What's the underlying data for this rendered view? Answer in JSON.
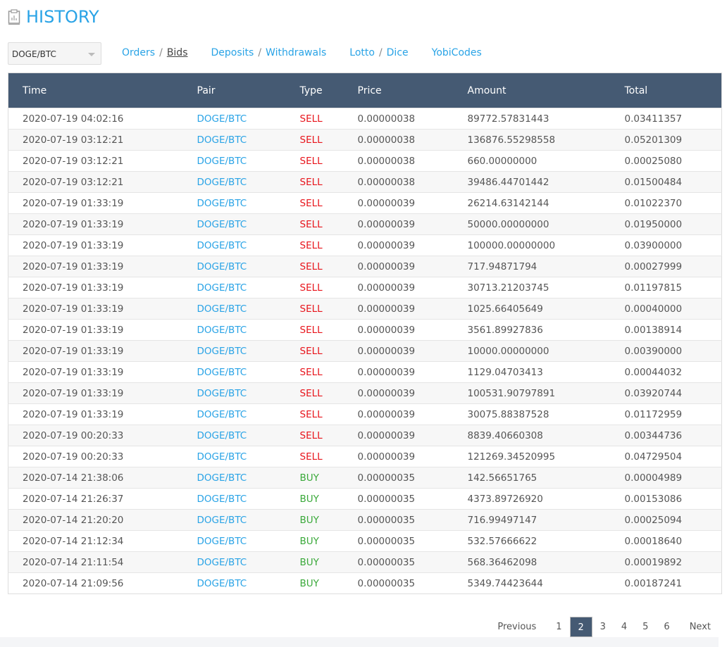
{
  "header": {
    "title": "HISTORY",
    "icon": "clipboard-chart-icon"
  },
  "pair_select": {
    "value": "DOGE/BTC"
  },
  "nav": [
    {
      "items": [
        "Orders",
        "Bids"
      ],
      "active": "Bids"
    },
    {
      "items": [
        "Deposits",
        "Withdrawals"
      ]
    },
    {
      "items": [
        "Lotto",
        "Dice"
      ]
    },
    {
      "items": [
        "YobiCodes"
      ]
    }
  ],
  "nav_separator": "/",
  "table": {
    "columns": [
      "Time",
      "Pair",
      "Type",
      "Price",
      "Amount",
      "Total"
    ],
    "rows": [
      [
        "2020-07-19 04:02:16",
        "DOGE/BTC",
        "SELL",
        "0.00000038",
        "89772.57831443",
        "0.03411357"
      ],
      [
        "2020-07-19 03:12:21",
        "DOGE/BTC",
        "SELL",
        "0.00000038",
        "136876.55298558",
        "0.05201309"
      ],
      [
        "2020-07-19 03:12:21",
        "DOGE/BTC",
        "SELL",
        "0.00000038",
        "660.00000000",
        "0.00025080"
      ],
      [
        "2020-07-19 03:12:21",
        "DOGE/BTC",
        "SELL",
        "0.00000038",
        "39486.44701442",
        "0.01500484"
      ],
      [
        "2020-07-19 01:33:19",
        "DOGE/BTC",
        "SELL",
        "0.00000039",
        "26214.63142144",
        "0.01022370"
      ],
      [
        "2020-07-19 01:33:19",
        "DOGE/BTC",
        "SELL",
        "0.00000039",
        "50000.00000000",
        "0.01950000"
      ],
      [
        "2020-07-19 01:33:19",
        "DOGE/BTC",
        "SELL",
        "0.00000039",
        "100000.00000000",
        "0.03900000"
      ],
      [
        "2020-07-19 01:33:19",
        "DOGE/BTC",
        "SELL",
        "0.00000039",
        "717.94871794",
        "0.00027999"
      ],
      [
        "2020-07-19 01:33:19",
        "DOGE/BTC",
        "SELL",
        "0.00000039",
        "30713.21203745",
        "0.01197815"
      ],
      [
        "2020-07-19 01:33:19",
        "DOGE/BTC",
        "SELL",
        "0.00000039",
        "1025.66405649",
        "0.00040000"
      ],
      [
        "2020-07-19 01:33:19",
        "DOGE/BTC",
        "SELL",
        "0.00000039",
        "3561.89927836",
        "0.00138914"
      ],
      [
        "2020-07-19 01:33:19",
        "DOGE/BTC",
        "SELL",
        "0.00000039",
        "10000.00000000",
        "0.00390000"
      ],
      [
        "2020-07-19 01:33:19",
        "DOGE/BTC",
        "SELL",
        "0.00000039",
        "1129.04703413",
        "0.00044032"
      ],
      [
        "2020-07-19 01:33:19",
        "DOGE/BTC",
        "SELL",
        "0.00000039",
        "100531.90797891",
        "0.03920744"
      ],
      [
        "2020-07-19 01:33:19",
        "DOGE/BTC",
        "SELL",
        "0.00000039",
        "30075.88387528",
        "0.01172959"
      ],
      [
        "2020-07-19 00:20:33",
        "DOGE/BTC",
        "SELL",
        "0.00000039",
        "8839.40660308",
        "0.00344736"
      ],
      [
        "2020-07-19 00:20:33",
        "DOGE/BTC",
        "SELL",
        "0.00000039",
        "121269.34520995",
        "0.04729504"
      ],
      [
        "2020-07-14 21:38:06",
        "DOGE/BTC",
        "BUY",
        "0.00000035",
        "142.56651765",
        "0.00004989"
      ],
      [
        "2020-07-14 21:26:37",
        "DOGE/BTC",
        "BUY",
        "0.00000035",
        "4373.89726920",
        "0.00153086"
      ],
      [
        "2020-07-14 21:20:20",
        "DOGE/BTC",
        "BUY",
        "0.00000035",
        "716.99497147",
        "0.00025094"
      ],
      [
        "2020-07-14 21:12:34",
        "DOGE/BTC",
        "BUY",
        "0.00000035",
        "532.57666622",
        "0.00018640"
      ],
      [
        "2020-07-14 21:11:54",
        "DOGE/BTC",
        "BUY",
        "0.00000035",
        "568.36462098",
        "0.00019892"
      ],
      [
        "2020-07-14 21:09:56",
        "DOGE/BTC",
        "BUY",
        "0.00000035",
        "5349.74423644",
        "0.00187241"
      ]
    ]
  },
  "pagination": {
    "previous": "Previous",
    "next": "Next",
    "pages": [
      "1",
      "2",
      "3",
      "4",
      "5",
      "6"
    ],
    "current": "2"
  },
  "colors": {
    "accent": "#29a3e6",
    "header_bg": "#455a73",
    "sell": "#e8141b",
    "buy": "#3aa93a"
  }
}
